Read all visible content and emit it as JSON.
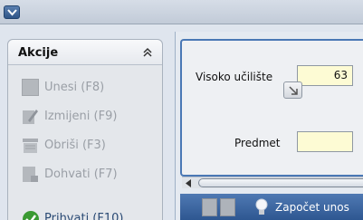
{
  "actions_panel": {
    "title": "Akcije",
    "items": [
      {
        "label": "Unesi (F8)",
        "enabled": false
      },
      {
        "label": "Izmijeni (F9)",
        "enabled": false
      },
      {
        "label": "Obriši (F3)",
        "enabled": false
      },
      {
        "label": "Dohvati (F7)",
        "enabled": false
      },
      {
        "label": "Prihvati (F10)",
        "enabled": true
      }
    ]
  },
  "form": {
    "visoko_uciliste": {
      "label": "Visoko učilište",
      "value": "63"
    },
    "predmet": {
      "label": "Predmet",
      "value": ""
    }
  },
  "toolbar": {
    "start_label": "Započet unos"
  },
  "colors": {
    "accent": "#2e5791",
    "input_background": "#fdfbd4",
    "disabled_text": "#9a9fa6"
  }
}
